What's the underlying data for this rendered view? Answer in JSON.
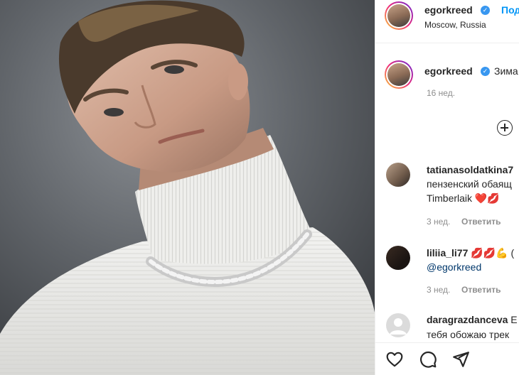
{
  "post": {
    "author": {
      "username": "egorkreed",
      "follow_label": "Подписаться",
      "follow_visible": "Под",
      "location": "Moscow, Russia"
    },
    "caption": {
      "username": "egorkreed",
      "text_visible": "Зима",
      "age": "16 нед."
    },
    "add_comment_icon": "plus-circle-icon"
  },
  "comments": [
    {
      "username": "tatianasoldatkina7",
      "line1": "пензенский обаящ",
      "line2": "Timberlaik ❤️💋",
      "age": "3 нед.",
      "reply_label": "Ответить"
    },
    {
      "username": "liliia_li77",
      "line1_suffix": "💋💋💪 (",
      "mention": "@egorkreed",
      "age": "3 нед.",
      "reply_label": "Ответить"
    },
    {
      "username": "daragrazdanceva",
      "line1_suffix": "Е",
      "line2": "тебя обожаю трек"
    }
  ],
  "actions": {
    "like_icon": "heart-icon",
    "comment_icon": "comment-icon",
    "share_icon": "paper-plane-icon"
  },
  "colors": {
    "link_blue": "#0095f6",
    "verified_blue": "#3897f0",
    "secondary_text": "#8e8e8e"
  }
}
